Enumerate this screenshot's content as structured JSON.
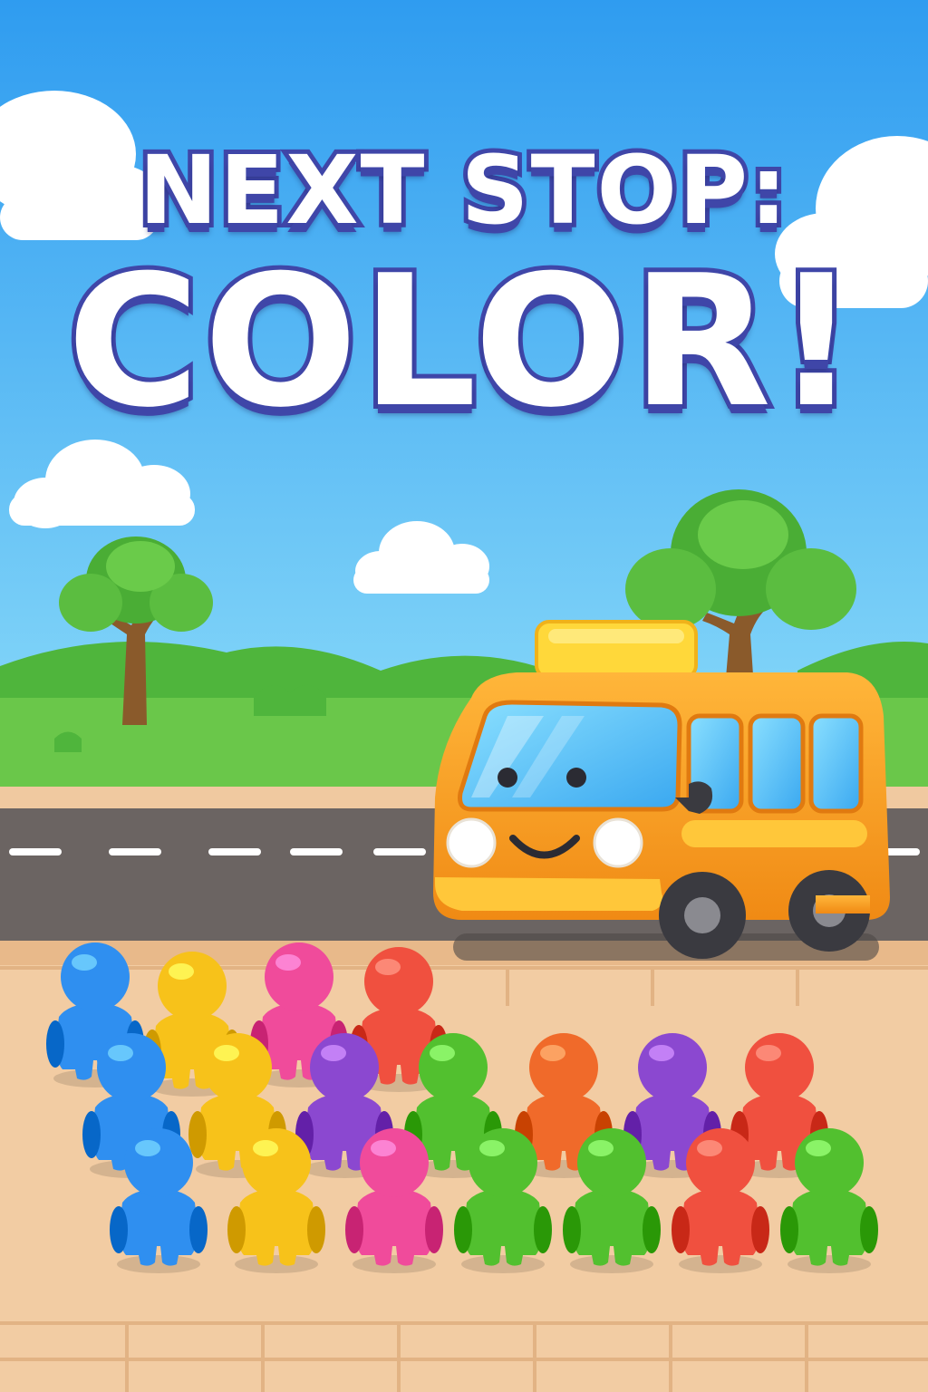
{
  "title": {
    "line1": "NEXT STOP:",
    "line2": "COLOR!"
  },
  "colors": {
    "sky_top": "#2f9cf0",
    "sky_bottom": "#6cc8f7",
    "grass": "#62c043",
    "hill": "#3fa236",
    "road": "#6b6462",
    "sidewalk": "#f0c9a0",
    "bus": "#f7a126",
    "bus_sign": "#ffd83a",
    "title_outline": "#3f46a8"
  },
  "passengers": [
    {
      "color": "#2f8ff0"
    },
    {
      "color": "#f7c21a"
    },
    {
      "color": "#f04b9b"
    },
    {
      "color": "#f0503f"
    },
    {
      "color": "#2f8ff0"
    },
    {
      "color": "#f7c21a"
    },
    {
      "color": "#8b48d0"
    },
    {
      "color": "#52c02f"
    },
    {
      "color": "#f06a2a"
    },
    {
      "color": "#8b48d0"
    },
    {
      "color": "#f0503f"
    },
    {
      "color": "#2f8ff0"
    },
    {
      "color": "#f7c21a"
    },
    {
      "color": "#f04b9b"
    },
    {
      "color": "#52c02f"
    },
    {
      "color": "#52c02f"
    },
    {
      "color": "#f0503f"
    },
    {
      "color": "#52c02f"
    }
  ]
}
